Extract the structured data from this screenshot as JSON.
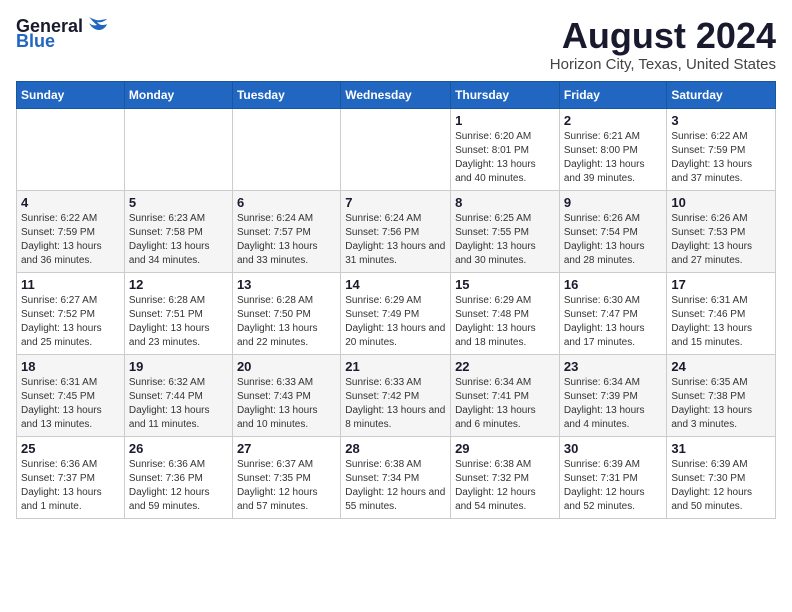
{
  "logo": {
    "general": "General",
    "blue": "Blue"
  },
  "title": "August 2024",
  "location": "Horizon City, Texas, United States",
  "days_of_week": [
    "Sunday",
    "Monday",
    "Tuesday",
    "Wednesday",
    "Thursday",
    "Friday",
    "Saturday"
  ],
  "weeks": [
    [
      {
        "day": "",
        "sunrise": "",
        "sunset": "",
        "daylight": ""
      },
      {
        "day": "",
        "sunrise": "",
        "sunset": "",
        "daylight": ""
      },
      {
        "day": "",
        "sunrise": "",
        "sunset": "",
        "daylight": ""
      },
      {
        "day": "",
        "sunrise": "",
        "sunset": "",
        "daylight": ""
      },
      {
        "day": "1",
        "sunrise": "Sunrise: 6:20 AM",
        "sunset": "Sunset: 8:01 PM",
        "daylight": "Daylight: 13 hours and 40 minutes."
      },
      {
        "day": "2",
        "sunrise": "Sunrise: 6:21 AM",
        "sunset": "Sunset: 8:00 PM",
        "daylight": "Daylight: 13 hours and 39 minutes."
      },
      {
        "day": "3",
        "sunrise": "Sunrise: 6:22 AM",
        "sunset": "Sunset: 7:59 PM",
        "daylight": "Daylight: 13 hours and 37 minutes."
      }
    ],
    [
      {
        "day": "4",
        "sunrise": "Sunrise: 6:22 AM",
        "sunset": "Sunset: 7:59 PM",
        "daylight": "Daylight: 13 hours and 36 minutes."
      },
      {
        "day": "5",
        "sunrise": "Sunrise: 6:23 AM",
        "sunset": "Sunset: 7:58 PM",
        "daylight": "Daylight: 13 hours and 34 minutes."
      },
      {
        "day": "6",
        "sunrise": "Sunrise: 6:24 AM",
        "sunset": "Sunset: 7:57 PM",
        "daylight": "Daylight: 13 hours and 33 minutes."
      },
      {
        "day": "7",
        "sunrise": "Sunrise: 6:24 AM",
        "sunset": "Sunset: 7:56 PM",
        "daylight": "Daylight: 13 hours and 31 minutes."
      },
      {
        "day": "8",
        "sunrise": "Sunrise: 6:25 AM",
        "sunset": "Sunset: 7:55 PM",
        "daylight": "Daylight: 13 hours and 30 minutes."
      },
      {
        "day": "9",
        "sunrise": "Sunrise: 6:26 AM",
        "sunset": "Sunset: 7:54 PM",
        "daylight": "Daylight: 13 hours and 28 minutes."
      },
      {
        "day": "10",
        "sunrise": "Sunrise: 6:26 AM",
        "sunset": "Sunset: 7:53 PM",
        "daylight": "Daylight: 13 hours and 27 minutes."
      }
    ],
    [
      {
        "day": "11",
        "sunrise": "Sunrise: 6:27 AM",
        "sunset": "Sunset: 7:52 PM",
        "daylight": "Daylight: 13 hours and 25 minutes."
      },
      {
        "day": "12",
        "sunrise": "Sunrise: 6:28 AM",
        "sunset": "Sunset: 7:51 PM",
        "daylight": "Daylight: 13 hours and 23 minutes."
      },
      {
        "day": "13",
        "sunrise": "Sunrise: 6:28 AM",
        "sunset": "Sunset: 7:50 PM",
        "daylight": "Daylight: 13 hours and 22 minutes."
      },
      {
        "day": "14",
        "sunrise": "Sunrise: 6:29 AM",
        "sunset": "Sunset: 7:49 PM",
        "daylight": "Daylight: 13 hours and 20 minutes."
      },
      {
        "day": "15",
        "sunrise": "Sunrise: 6:29 AM",
        "sunset": "Sunset: 7:48 PM",
        "daylight": "Daylight: 13 hours and 18 minutes."
      },
      {
        "day": "16",
        "sunrise": "Sunrise: 6:30 AM",
        "sunset": "Sunset: 7:47 PM",
        "daylight": "Daylight: 13 hours and 17 minutes."
      },
      {
        "day": "17",
        "sunrise": "Sunrise: 6:31 AM",
        "sunset": "Sunset: 7:46 PM",
        "daylight": "Daylight: 13 hours and 15 minutes."
      }
    ],
    [
      {
        "day": "18",
        "sunrise": "Sunrise: 6:31 AM",
        "sunset": "Sunset: 7:45 PM",
        "daylight": "Daylight: 13 hours and 13 minutes."
      },
      {
        "day": "19",
        "sunrise": "Sunrise: 6:32 AM",
        "sunset": "Sunset: 7:44 PM",
        "daylight": "Daylight: 13 hours and 11 minutes."
      },
      {
        "day": "20",
        "sunrise": "Sunrise: 6:33 AM",
        "sunset": "Sunset: 7:43 PM",
        "daylight": "Daylight: 13 hours and 10 minutes."
      },
      {
        "day": "21",
        "sunrise": "Sunrise: 6:33 AM",
        "sunset": "Sunset: 7:42 PM",
        "daylight": "Daylight: 13 hours and 8 minutes."
      },
      {
        "day": "22",
        "sunrise": "Sunrise: 6:34 AM",
        "sunset": "Sunset: 7:41 PM",
        "daylight": "Daylight: 13 hours and 6 minutes."
      },
      {
        "day": "23",
        "sunrise": "Sunrise: 6:34 AM",
        "sunset": "Sunset: 7:39 PM",
        "daylight": "Daylight: 13 hours and 4 minutes."
      },
      {
        "day": "24",
        "sunrise": "Sunrise: 6:35 AM",
        "sunset": "Sunset: 7:38 PM",
        "daylight": "Daylight: 13 hours and 3 minutes."
      }
    ],
    [
      {
        "day": "25",
        "sunrise": "Sunrise: 6:36 AM",
        "sunset": "Sunset: 7:37 PM",
        "daylight": "Daylight: 13 hours and 1 minute."
      },
      {
        "day": "26",
        "sunrise": "Sunrise: 6:36 AM",
        "sunset": "Sunset: 7:36 PM",
        "daylight": "Daylight: 12 hours and 59 minutes."
      },
      {
        "day": "27",
        "sunrise": "Sunrise: 6:37 AM",
        "sunset": "Sunset: 7:35 PM",
        "daylight": "Daylight: 12 hours and 57 minutes."
      },
      {
        "day": "28",
        "sunrise": "Sunrise: 6:38 AM",
        "sunset": "Sunset: 7:34 PM",
        "daylight": "Daylight: 12 hours and 55 minutes."
      },
      {
        "day": "29",
        "sunrise": "Sunrise: 6:38 AM",
        "sunset": "Sunset: 7:32 PM",
        "daylight": "Daylight: 12 hours and 54 minutes."
      },
      {
        "day": "30",
        "sunrise": "Sunrise: 6:39 AM",
        "sunset": "Sunset: 7:31 PM",
        "daylight": "Daylight: 12 hours and 52 minutes."
      },
      {
        "day": "31",
        "sunrise": "Sunrise: 6:39 AM",
        "sunset": "Sunset: 7:30 PM",
        "daylight": "Daylight: 12 hours and 50 minutes."
      }
    ]
  ]
}
